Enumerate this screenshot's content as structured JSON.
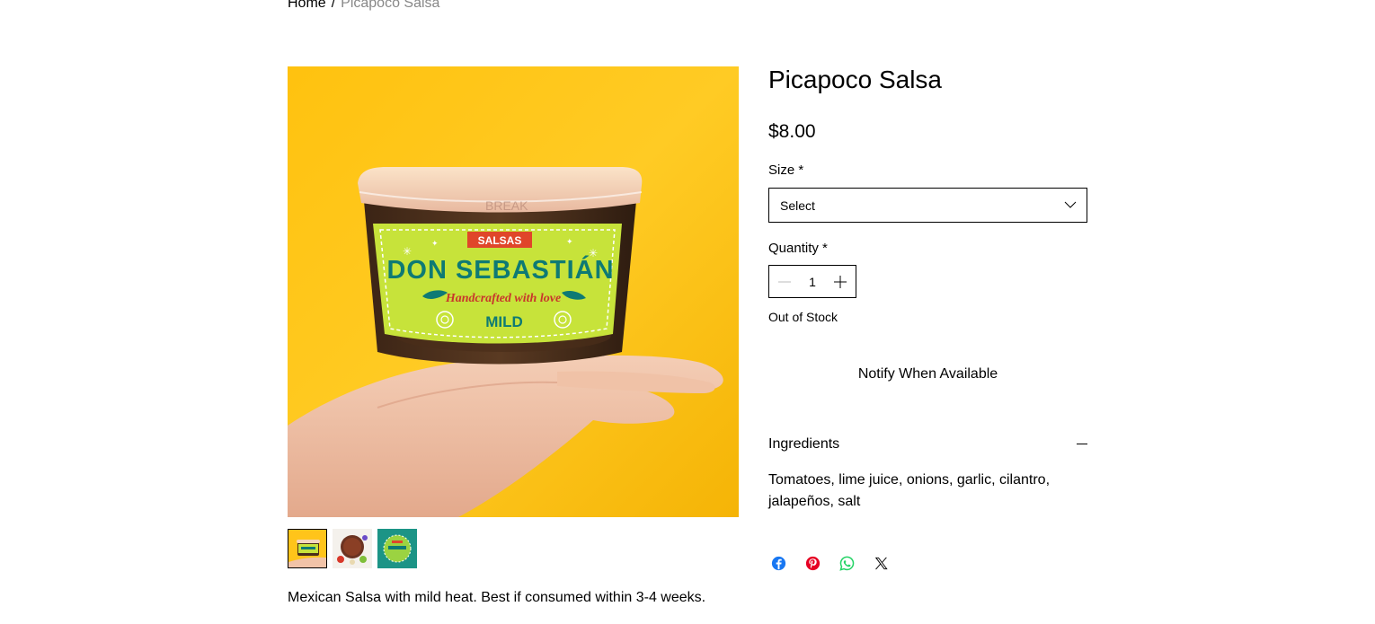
{
  "breadcrumb": {
    "home": "Home",
    "separator": "/",
    "current": "Picapoco Salsa"
  },
  "product": {
    "title": "Picapoco Salsa",
    "price": "$8.00",
    "description": "Mexican Salsa with mild heat. Best if consumed within 3-4 weeks.",
    "image_label": {
      "brand_top": "SALSAS",
      "brand": "DON SEBASTIÁN",
      "tagline": "Handcrafted with love",
      "heat": "MILD",
      "lid_text": "BREAK"
    },
    "thumbnails": [
      {
        "name": "thumb-salsa-hand",
        "selected": true
      },
      {
        "name": "thumb-salsa-bowl",
        "selected": false
      },
      {
        "name": "thumb-salsa-jar-teal",
        "selected": false
      }
    ]
  },
  "options": {
    "size_label": "Size *",
    "size_value": "Select",
    "quantity_label": "Quantity *",
    "quantity_value": "1",
    "stock_status": "Out of Stock",
    "notify_label": "Notify When Available"
  },
  "ingredients": {
    "title": "Ingredients",
    "text": "Tomatoes, lime juice, onions, garlic, cilantro, jalapeños, salt"
  },
  "share": [
    {
      "name": "facebook-icon",
      "color": "#1877F2"
    },
    {
      "name": "pinterest-icon",
      "color": "#E60023"
    },
    {
      "name": "whatsapp-icon",
      "color": "#25D366"
    },
    {
      "name": "x-icon",
      "color": "#000000"
    }
  ],
  "colors": {
    "background_yellow": "#FFC41A",
    "label_green": "#C7E33A",
    "label_teal": "#0E7A74",
    "banner_red": "#E0462A"
  }
}
